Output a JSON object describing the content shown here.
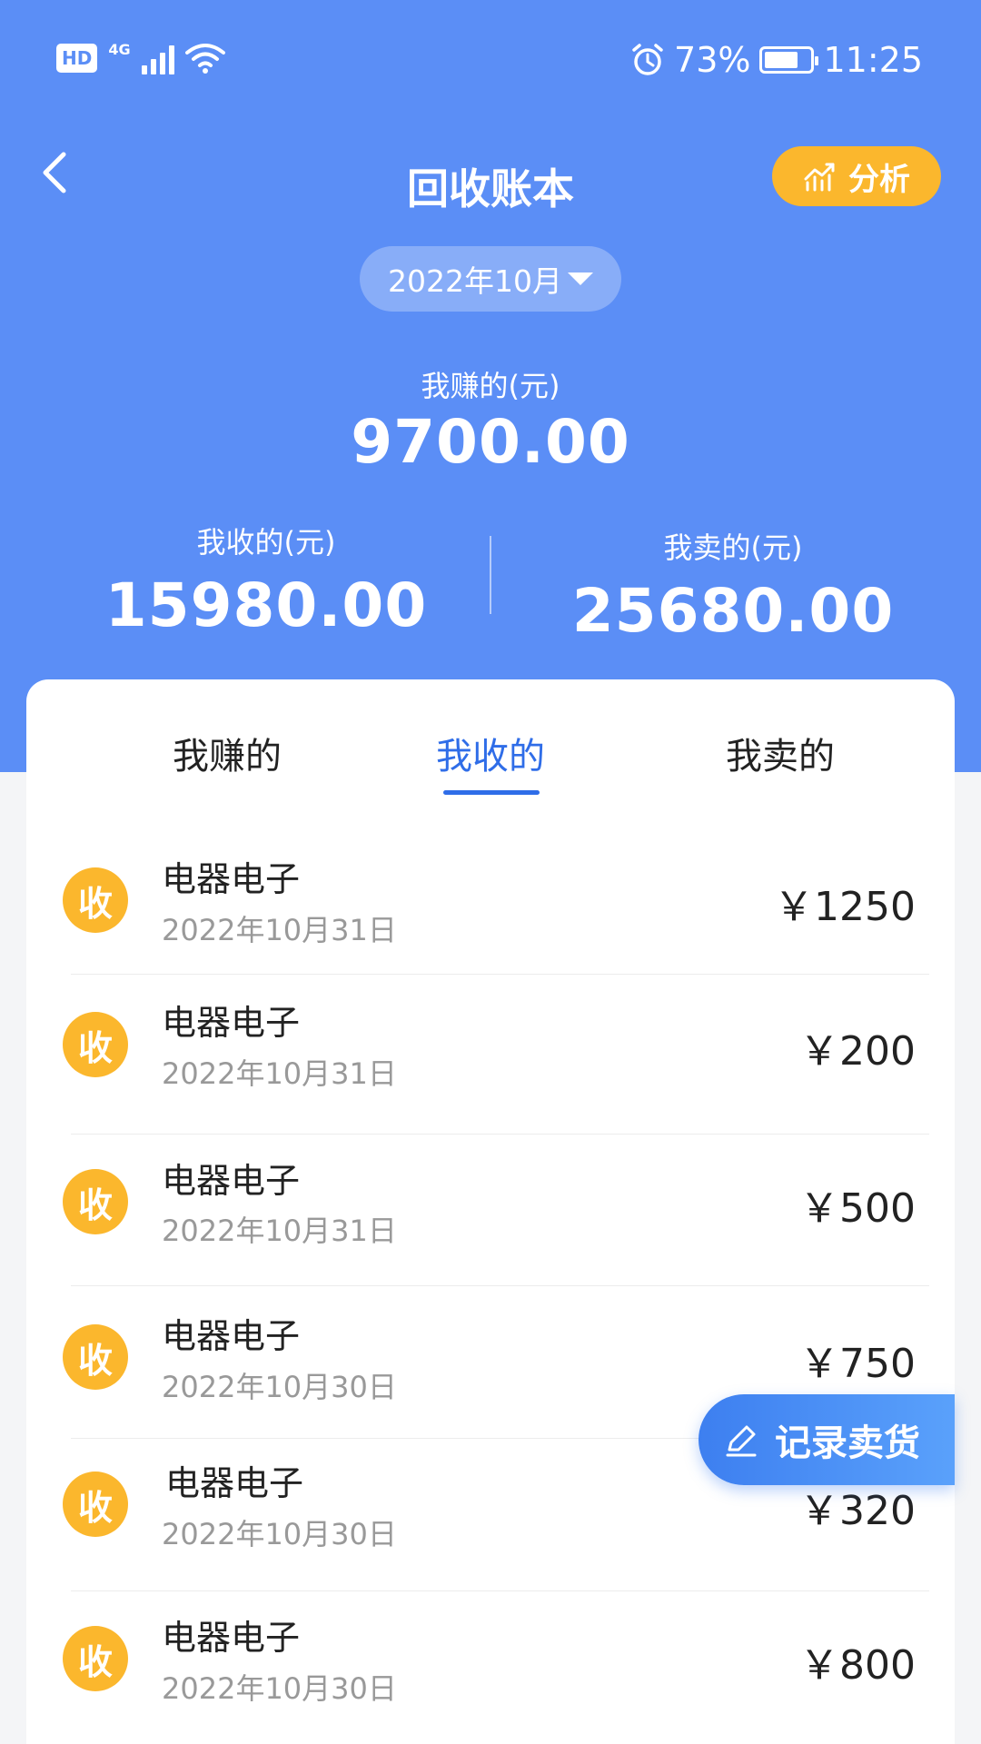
{
  "status_bar": {
    "hd": "HD",
    "network": "4G",
    "battery_percent": "73%",
    "battery_level": 0.73,
    "time": "11:25"
  },
  "header": {
    "title": "回收账本",
    "analyze_label": "分析",
    "month": "2022年10月"
  },
  "summary": {
    "earn_label": "我赚的(元)",
    "earn_value": "9700.00",
    "collect_label": "我收的(元)",
    "collect_value": "15980.00",
    "sell_label": "我卖的(元)",
    "sell_value": "25680.00"
  },
  "tabs": [
    {
      "label": "我赚的",
      "active": false
    },
    {
      "label": "我收的",
      "active": true
    },
    {
      "label": "我卖的",
      "active": false
    }
  ],
  "records": [
    {
      "badge": "收",
      "name": "电器电子",
      "date": "2022年10月31日",
      "amount": "￥1250"
    },
    {
      "badge": "收",
      "name": "电器电子",
      "date": "2022年10月31日",
      "amount": "￥200"
    },
    {
      "badge": "收",
      "name": "电器电子",
      "date": "2022年10月31日",
      "amount": "￥500"
    },
    {
      "badge": "收",
      "name": "电器电子",
      "date": "2022年10月30日",
      "amount": "￥750"
    },
    {
      "badge": "收",
      "name": "电器电子",
      "date": "2022年10月30日",
      "amount": "￥320"
    },
    {
      "badge": "收",
      "name": "电器电子",
      "date": "2022年10月30日",
      "amount": "￥800"
    }
  ],
  "fab": {
    "label": "记录卖货"
  },
  "colors": {
    "primary": "#5b8ef6",
    "accent": "#fbb72d",
    "active_tab": "#2f6de8"
  }
}
